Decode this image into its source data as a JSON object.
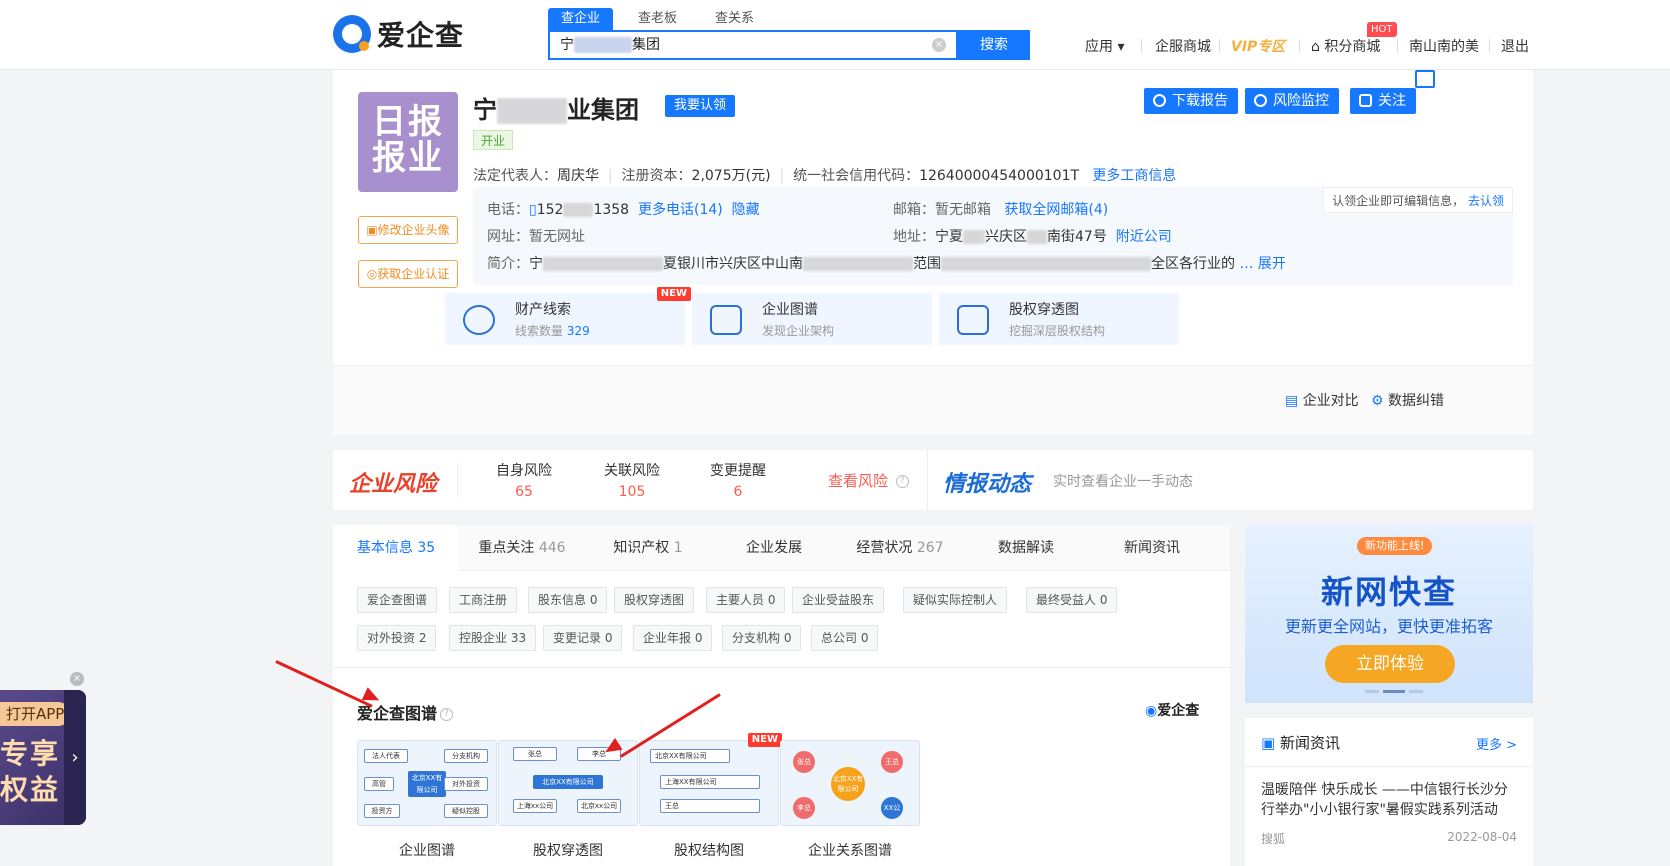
{
  "header": {
    "logo_text": "爱企查",
    "search_tabs": [
      "查企业",
      "查老板",
      "查关系"
    ],
    "search_value_left": "宁",
    "search_value_right": "集团",
    "search_button": "搜索",
    "nav": {
      "apps": "应用",
      "mall": "企服商城",
      "vip": "VIP专区",
      "points": "积分商城",
      "hot": "HOT",
      "user": "南山南的美",
      "logout": "退出"
    }
  },
  "company": {
    "logo_text_1": "日报",
    "logo_text_2": "报业",
    "name_left": "宁",
    "name_right": "业集团",
    "claim": "我要认领",
    "status": "开业",
    "edit_avatar": "修改企业头像",
    "get_cert": "获取企业认证",
    "legal_rep_label": "法定代表人：",
    "legal_rep": "周庆华",
    "capital_label": "注册资本：",
    "capital": "2,075万(元)",
    "credit_label": "统一社会信用代码：",
    "credit_code": "12640000454000101T",
    "more_biz": "更多工商信息",
    "actions": {
      "download": "下载报告",
      "monitor": "风险监控",
      "follow": "关注"
    },
    "phone_label": "电话：",
    "phone_left": "152",
    "phone_right": "1358",
    "more_phone": "更多电话(14)",
    "hide": "隐藏",
    "email_label": "邮箱：",
    "email": "暂无邮箱",
    "all_email": "获取全网邮箱(4)",
    "site_label": "网址：",
    "site": "暂无网址",
    "addr_label": "地址：",
    "addr_left": "宁夏",
    "addr_mid": "兴庆区",
    "addr_right": "南街47号",
    "nearby": "附近公司",
    "intro_label": "简介：",
    "intro_left": "宁",
    "intro_mid": "夏银川市兴庆区中山南",
    "intro_mid2": "范围",
    "intro_right": "全区各行业的",
    "expand": "展开",
    "notice": "认领企业即可编辑信息，",
    "notice_link": "去认领",
    "features": [
      {
        "title": "财产线索",
        "sub_label": "线索数量",
        "sub_value": "329",
        "new": "NEW"
      },
      {
        "title": "企业图谱",
        "sub": "发现企业架构"
      },
      {
        "title": "股权穿透图",
        "sub": "挖掘深层股权结构"
      }
    ],
    "compare": "企业对比",
    "correct": "数据纠错"
  },
  "risk": {
    "title": "企业风险",
    "items": [
      {
        "label": "自身风险",
        "count": "65"
      },
      {
        "label": "关联风险",
        "count": "105"
      },
      {
        "label": "变更提醒",
        "count": "6"
      }
    ],
    "view": "查看风险",
    "intel_title": "情报动态",
    "intel_text": "实时查看企业一手动态"
  },
  "main": {
    "tabs": [
      {
        "label": "基本信息",
        "count": "35"
      },
      {
        "label": "重点关注",
        "count": "446"
      },
      {
        "label": "知识产权",
        "count": "1"
      },
      {
        "label": "企业发展",
        "count": ""
      },
      {
        "label": "经营状况",
        "count": "267"
      },
      {
        "label": "数据解读",
        "count": ""
      },
      {
        "label": "新闻资讯",
        "count": ""
      }
    ],
    "chips_row1": [
      "爱企查图谱",
      "工商注册",
      "股东信息 0",
      "股权穿透图",
      "主要人员 0",
      "企业受益股东",
      "疑似实际控制人",
      "最终受益人 0"
    ],
    "chips_row2": [
      "对外投资 2",
      "控股企业 33",
      "变更记录 0",
      "企业年报 0",
      "分支机构 0",
      "总公司 0"
    ],
    "section_title": "爱企查图谱",
    "mini_logo": "爱企查",
    "tiles": [
      {
        "caption": "企业图谱",
        "nodes": [
          "法人代表",
          "分支机构",
          "高管",
          "北京XX有限公司",
          "对外投资",
          "投资方",
          "疑似控股"
        ]
      },
      {
        "caption": "股权穿透图",
        "nodes": [
          "张总",
          "李总",
          "北京XX有限公司",
          "上海xx公司",
          "北京xx公司"
        ]
      },
      {
        "caption": "股权结构图",
        "nodes": [
          "北京XX有限公司",
          "上海XX有限公司",
          "王总"
        ],
        "new": "NEW"
      },
      {
        "caption": "企业关系图谱",
        "nodes": [
          "张总",
          "王总",
          "北京XX有限公司",
          "李总",
          "XX公司"
        ]
      }
    ]
  },
  "promo": {
    "tag": "新功能上线!",
    "title": "新网快查",
    "sub": "更新更全网站，更快更准拓客",
    "button": "立即体验"
  },
  "news": {
    "title": "新闻资讯",
    "more": "更多 >",
    "headline": "温暖陪伴 快乐成长 ——中信银行长沙分行举办\"小小银行家\"暑假实践系列活动",
    "source": "搜狐",
    "date": "2022-08-04"
  },
  "app_float": {
    "pill": "打开APP",
    "big1": "专享",
    "big2": "权益",
    "chevron": "›",
    "close": "×"
  },
  "colors": {
    "accent": "#1677ff",
    "risk": "#ff5b4d",
    "orange": "#f08c1f"
  }
}
